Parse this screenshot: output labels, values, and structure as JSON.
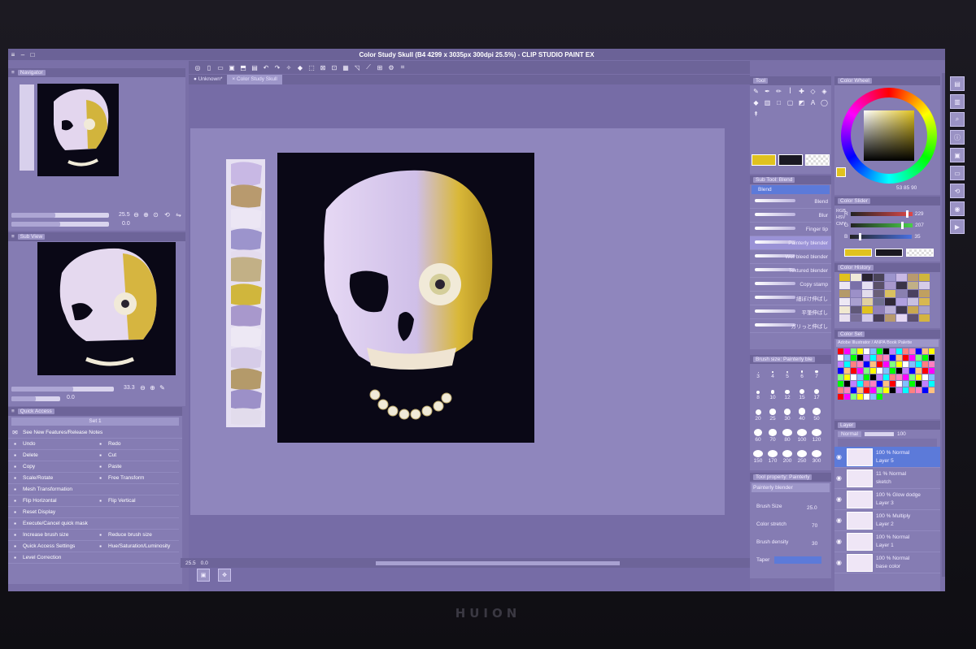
{
  "window": {
    "title": "Color Study Skull (B4 4299 x 3035px 300dpi 25.5%)  - CLIP STUDIO PAINT EX"
  },
  "tabs": [
    {
      "label": "Unknown*"
    },
    {
      "label": "Color Study Skull"
    }
  ],
  "navigator": {
    "title": "Navigator",
    "zoom": "25.5",
    "angle": "0.0"
  },
  "subview": {
    "title": "Sub View",
    "zoom": "33.3",
    "angle": "0.0"
  },
  "quick_access": {
    "title": "Quick Access",
    "set": "Set 1",
    "notes": "See New Features/Release Notes",
    "left": [
      "Undo",
      "Delete",
      "Copy",
      "Scale/Rotate",
      "Mesh Transformation",
      "Flip Horizontal",
      "Reset Display",
      "Execute/Cancel quick mask",
      "Increase brush size",
      "Quick Access Settings",
      "Level Correction"
    ],
    "right": [
      "Redo",
      "Cut",
      "Paste",
      "Free Transform",
      "",
      "Flip Vertical",
      "",
      "",
      "Reduce brush size",
      "Hue/Saturation/Luminosity",
      ""
    ]
  },
  "tool_panel": {
    "title": "Tool"
  },
  "subtool_panel": {
    "title": "Sub Tool: Blend",
    "group": "Blend",
    "items": [
      "Blend",
      "Blur",
      "Finger tip",
      "Painterly blender",
      "Wet bleed blender",
      "Textured blender",
      "Copy stamp",
      "細ぼけ伸ばし",
      "平筆伸ばし",
      "ガリっと伸ばし"
    ]
  },
  "brush_size": {
    "title": "Brush size: Painterly ble",
    "sizes": [
      "3",
      "4",
      "5",
      "6",
      "7",
      "8",
      "10",
      "12",
      "15",
      "17",
      "20",
      "25",
      "30",
      "40",
      "50",
      "60",
      "70",
      "80",
      "100",
      "120",
      "150",
      "170",
      "200",
      "250",
      "300"
    ]
  },
  "tool_property": {
    "title": "Tool property: Painterly",
    "name": "Painterly blender",
    "brush_size_label": "Brush Size",
    "brush_size_value": "25.0",
    "color_stretch_label": "Color stretch",
    "color_stretch_value": "70",
    "brush_density_label": "Brush density",
    "brush_density_value": "30",
    "taper_label": "Taper"
  },
  "color_wheel": {
    "title": "Color Wheel",
    "readout": "53  85  90"
  },
  "color_slider": {
    "title": "Color Slider",
    "mode_tags": [
      "RGB",
      "HSV",
      "CMY"
    ],
    "r_label": "R",
    "r_value": "229",
    "r_fraction": 0.9,
    "g_label": "G",
    "g_value": "207",
    "g_fraction": 0.81,
    "b_label": "B",
    "b_value": "35",
    "b_fraction": 0.14
  },
  "color_history": {
    "title": "Color History"
  },
  "color_set": {
    "title": "Color Set",
    "palette": "Adobe Illustrator / ANPA Book Palette"
  },
  "layer_panel": {
    "title": "Layer",
    "blend_mode": "Normal",
    "opacity": "100",
    "layers": [
      {
        "mode": "100 % Normal",
        "name": "Layer 5"
      },
      {
        "mode": "11 % Normal",
        "name": "sketch"
      },
      {
        "mode": "100 % Glow dodge",
        "name": "Layer 3"
      },
      {
        "mode": "100 % Multiply",
        "name": "Layer 2"
      },
      {
        "mode": "100 % Normal",
        "name": "Layer 1"
      },
      {
        "mode": "100 % Normal",
        "name": "base color"
      }
    ]
  },
  "status": {
    "zoom": "25.5",
    "angle": "0.0"
  },
  "bezel": {
    "brand": "HUION"
  },
  "colors": {
    "accent": "#e0c21e",
    "panel": "#857cb3",
    "header": "#6d6499",
    "canvas_bg": "#0a0816"
  }
}
